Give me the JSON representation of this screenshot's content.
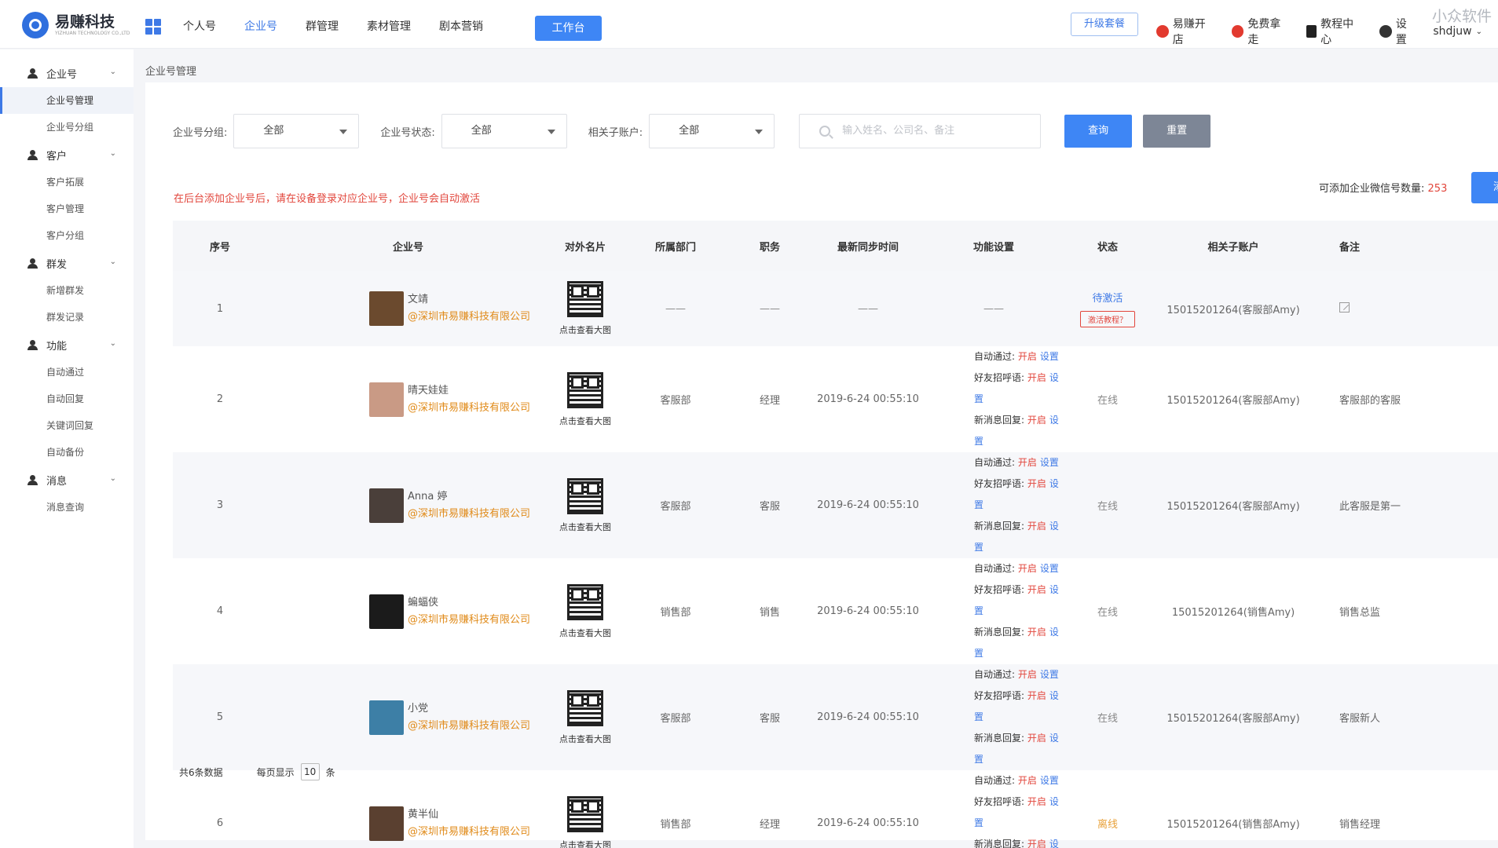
{
  "header": {
    "logo_name": "易赚科技",
    "logo_sub": "YIZHUAN TECHNOLOGY CO.,LTD",
    "nav": [
      "个人号",
      "企业号",
      "群管理",
      "素材管理",
      "剧本营销"
    ],
    "workbench": "工作台",
    "upgrade": "升级套餐",
    "tools": [
      "易赚开店",
      "免费拿走",
      "教程中心",
      "设置"
    ],
    "user": "shdjuw",
    "watermark": "小众软件",
    "accent_color": "#3e79e6"
  },
  "sidebar": {
    "groups": [
      {
        "label": "企业号",
        "items": [
          "企业号管理",
          "企业号分组"
        ]
      },
      {
        "label": "客户",
        "items": [
          "客户拓展",
          "客户管理",
          "客户分组"
        ]
      },
      {
        "label": "群发",
        "items": [
          "新增群发",
          "群发记录"
        ]
      },
      {
        "label": "功能",
        "items": [
          "自动通过",
          "自动回复",
          "关键词回复",
          "自动备份"
        ]
      },
      {
        "label": "消息",
        "items": [
          "消息查询"
        ]
      }
    ]
  },
  "breadcrumb": "企业号管理",
  "filters": {
    "group_label": "企业号分组:",
    "group_value": "全部",
    "status_label": "企业号状态:",
    "status_value": "全部",
    "sub_label": "相关子账户:",
    "sub_value": "全部",
    "search_placeholder": "输入姓名、公司名、备注",
    "query": "查询",
    "reset": "重置"
  },
  "notice": "在后台添加企业号后，请在设备登录对应企业号，企业号会自动激活",
  "quota_label": "可添加企业微信号数量:",
  "quota_value": "253",
  "add_button": "添加",
  "table": {
    "headers": [
      "序号",
      "企业号",
      "对外名片",
      "所属部门",
      "职务",
      "最新同步时间",
      "功能设置",
      "状态",
      "相关子账户",
      "备注"
    ],
    "qr_caption": "点击查看大图",
    "func_labels": [
      "自动通过:",
      "好友招呼语:",
      "新消息回复:"
    ],
    "func_on": "开启",
    "func_set": "设置",
    "dash": "——",
    "activate_tutorial": "激活教程？",
    "rows": [
      {
        "no": "1",
        "name": "文靖",
        "company": "@深圳市易赚科技有限公司",
        "dept": "——",
        "title": "——",
        "sync": "——",
        "status": "待激活",
        "sub": "15015201264(客服部Amy)",
        "note": "",
        "avatar_color": "#6b4a2e"
      },
      {
        "no": "2",
        "name": "晴天娃娃",
        "company": "@深圳市易赚科技有限公司",
        "dept": "客服部",
        "title": "经理",
        "sync": "2019-6-24 00:55:10",
        "status": "在线",
        "sub": "15015201264(客服部Amy)",
        "note": "客服部的客服",
        "avatar_color": "#c99a85"
      },
      {
        "no": "3",
        "name": "Anna 婷",
        "company": "@深圳市易赚科技有限公司",
        "dept": "客服部",
        "title": "客服",
        "sync": "2019-6-24 00:55:10",
        "status": "在线",
        "sub": "15015201264(客服部Amy)",
        "note": "此客服是第一",
        "avatar_color": "#4a3f3a"
      },
      {
        "no": "4",
        "name": "蝙蝠侠",
        "company": "@深圳市易赚科技有限公司",
        "dept": "销售部",
        "title": "销售",
        "sync": "2019-6-24 00:55:10",
        "status": "在线",
        "sub": "15015201264(销售Amy)",
        "note": "销售总监",
        "avatar_color": "#1b1b1b"
      },
      {
        "no": "5",
        "name": "小党",
        "company": "@深圳市易赚科技有限公司",
        "dept": "客服部",
        "title": "客服",
        "sync": "2019-6-24 00:55:10",
        "status": "在线",
        "sub": "15015201264(客服部Amy)",
        "note": "客服新人",
        "avatar_color": "#3d7fa6"
      },
      {
        "no": "6",
        "name": "黄半仙",
        "company": "@深圳市易赚科技有限公司",
        "dept": "销售部",
        "title": "经理",
        "sync": "2019-6-24 00:55:10",
        "status": "离线",
        "sub": "15015201264(销售部Amy)",
        "note": "销售经理",
        "avatar_color": "#5a4030"
      }
    ]
  },
  "pager": {
    "total": "共6条数据",
    "per_page_label": "每页显示",
    "per_page": "10",
    "unit": "条"
  }
}
